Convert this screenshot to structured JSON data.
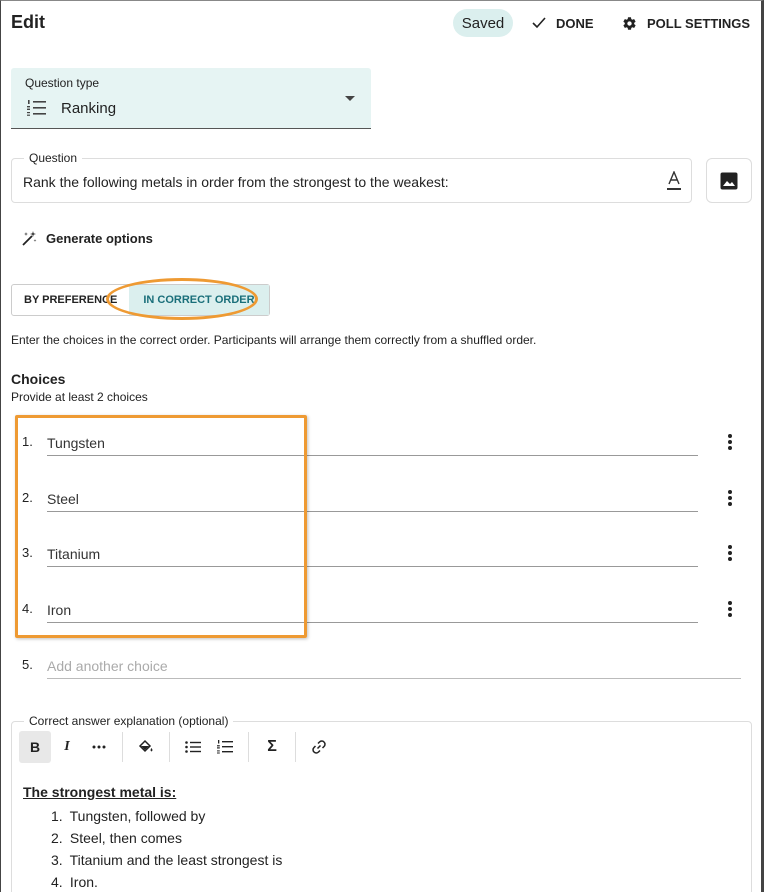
{
  "header": {
    "title": "Edit",
    "saved_label": "Saved",
    "done_label": "DONE",
    "settings_label": "POLL SETTINGS"
  },
  "question_type": {
    "label": "Question type",
    "value": "Ranking",
    "icon": "list-ordered-icon"
  },
  "question": {
    "legend": "Question",
    "text": "Rank the following metals in order from the strongest to the weakest:"
  },
  "generate_label": "Generate options",
  "mode": {
    "options": [
      "BY PREFERENCE",
      "IN CORRECT ORDER"
    ],
    "selected": "IN CORRECT ORDER"
  },
  "instructions": "Enter the choices in the correct order. Participants will arrange them correctly from a shuffled order.",
  "choices": {
    "title": "Choices",
    "hint": "Provide at least 2 choices",
    "items": [
      {
        "num": "1.",
        "value": "Tungsten"
      },
      {
        "num": "2.",
        "value": "Steel"
      },
      {
        "num": "3.",
        "value": "Titanium"
      },
      {
        "num": "4.",
        "value": "Iron"
      }
    ],
    "add": {
      "num": "5.",
      "placeholder": "Add another choice"
    }
  },
  "explanation": {
    "legend": "Correct answer explanation (optional)",
    "heading": "The strongest metal is:",
    "list": [
      {
        "n": "1.",
        "text": "Tungsten, followed by"
      },
      {
        "n": "2.",
        "text": "Steel, then comes"
      },
      {
        "n": "3.",
        "text": "Titanium and the least strongest is"
      },
      {
        "n": "4.",
        "text": "Iron."
      }
    ]
  },
  "colors": {
    "accent": "#dbefee",
    "accent_text": "#1a6f7a",
    "highlight": "#ee9a33"
  }
}
